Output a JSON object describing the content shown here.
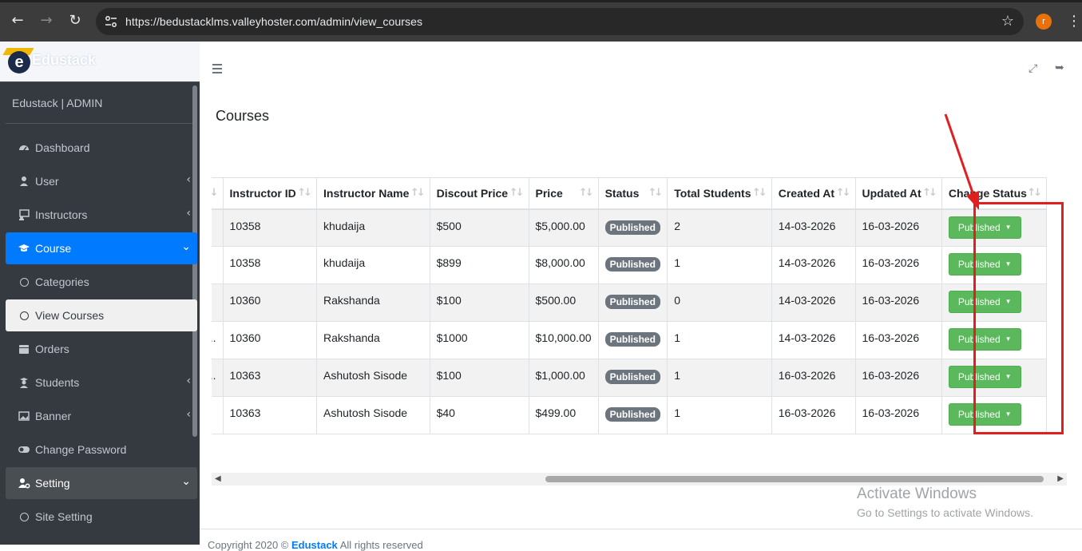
{
  "browser": {
    "url": "https://bedustacklms.valleyhoster.com/admin/view_courses",
    "profile_initial": "r"
  },
  "sidebar": {
    "brand": "Edustack",
    "user_panel": "Edustack | ADMIN",
    "items": [
      {
        "label": "Dashboard",
        "icon": "dashboard-icon"
      },
      {
        "label": "User",
        "icon": "user-icon",
        "caret": "‹"
      },
      {
        "label": "Instructors",
        "icon": "instructors-icon",
        "caret": "‹"
      },
      {
        "label": "Course",
        "icon": "graduation-cap-icon",
        "caret": "⌄"
      },
      {
        "label": "Categories",
        "icon": "circle-icon"
      },
      {
        "label": "View Courses",
        "icon": "circle-icon"
      },
      {
        "label": "Orders",
        "icon": "calendar-icon"
      },
      {
        "label": "Students",
        "icon": "students-icon",
        "caret": "‹"
      },
      {
        "label": "Banner",
        "icon": "image-icon",
        "caret": "‹"
      },
      {
        "label": "Change Password",
        "icon": "toggle-icon"
      },
      {
        "label": "Setting",
        "icon": "user-gear-icon",
        "caret": "⌄"
      },
      {
        "label": "Site Setting",
        "icon": "circle-icon"
      }
    ]
  },
  "page": {
    "title": "Courses"
  },
  "table": {
    "columns": [
      "",
      "Instructor ID",
      "Instructor Name",
      "Discout Price",
      "Price",
      "Status",
      "Total Students",
      "Created At",
      "Updated At",
      "Change Status"
    ],
    "rows": [
      {
        "prefix": "",
        "instructor_id": "10358",
        "instructor_name": "khudaija",
        "discount": "$500",
        "price": "$5,000.00",
        "status": "Published",
        "students": "2",
        "created": "14-03-2026",
        "updated": "16-03-2026",
        "action": "Published"
      },
      {
        "prefix": "",
        "instructor_id": "10358",
        "instructor_name": "khudaija",
        "discount": "$899",
        "price": "$8,000.00",
        "status": "Published",
        "students": "1",
        "created": "14-03-2026",
        "updated": "16-03-2026",
        "action": "Published"
      },
      {
        "prefix": "",
        "instructor_id": "10360",
        "instructor_name": "Rakshanda",
        "discount": "$100",
        "price": "$500.00",
        "status": "Published",
        "students": "0",
        "created": "14-03-2026",
        "updated": "16-03-2026",
        "action": "Published"
      },
      {
        "prefix": "..",
        "instructor_id": "10360",
        "instructor_name": "Rakshanda",
        "discount": "$1000",
        "price": "$10,000.00",
        "status": "Published",
        "students": "1",
        "created": "14-03-2026",
        "updated": "16-03-2026",
        "action": "Published"
      },
      {
        "prefix": "u...",
        "instructor_id": "10363",
        "instructor_name": "Ashutosh Sisode",
        "discount": "$100",
        "price": "$1,000.00",
        "status": "Published",
        "students": "1",
        "created": "16-03-2026",
        "updated": "16-03-2026",
        "action": "Published"
      },
      {
        "prefix": "",
        "instructor_id": "10363",
        "instructor_name": "Ashutosh Sisode",
        "discount": "$40",
        "price": "$499.00",
        "status": "Published",
        "students": "1",
        "created": "16-03-2026",
        "updated": "16-03-2026",
        "action": "Published"
      }
    ]
  },
  "footer": {
    "prefix": "Copyright 2020 © ",
    "link": "Edustack",
    "suffix": " All rights reserved"
  },
  "watermark": {
    "line1": "Activate Windows",
    "line2": "Go to Settings to activate Windows."
  },
  "colors": {
    "sidebar_bg": "#343a40",
    "active_item": "#007bff",
    "published_badge": "#6c757d",
    "published_button": "#5cb85c",
    "annotation": "#e02020"
  }
}
